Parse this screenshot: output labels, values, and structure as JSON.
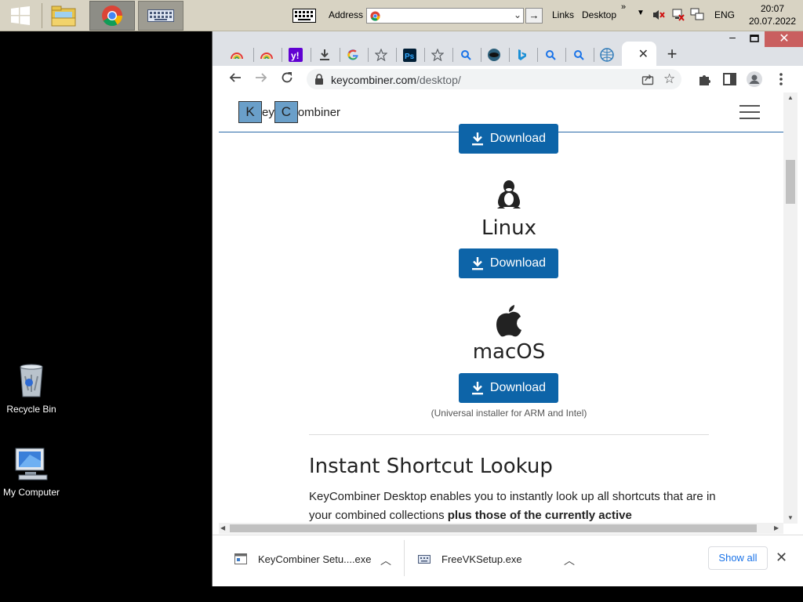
{
  "taskbar": {
    "address_label": "Address",
    "go_label": "→",
    "links_label": "Links",
    "desktop_label": "Desktop",
    "more_label": "»",
    "menu_label": "▼",
    "language": "ENG",
    "time": "20:07",
    "date": "20.07.2022"
  },
  "desktop": {
    "icons": [
      {
        "label": "Recycle Bin"
      },
      {
        "label": "My Computer"
      }
    ]
  },
  "browser": {
    "window_controls": {
      "minimize": "–",
      "close": "✕"
    },
    "active_tab_close": "✕",
    "new_tab": "+",
    "url_domain": "keycombiner.com",
    "url_path": "/desktop/"
  },
  "page": {
    "logo": {
      "key1": "K",
      "text1": "ey",
      "key2": "C",
      "text2": "ombiner"
    },
    "downloads": [
      {
        "os": "",
        "button": "Download"
      },
      {
        "os": "Linux",
        "button": "Download"
      },
      {
        "os": "macOS",
        "button": "Download"
      }
    ],
    "mac_note": "(Universal installer for ARM and Intel)",
    "section_title": "Instant Shortcut Lookup",
    "section_body_start": "KeyCombiner Desktop enables you to instantly look up all shortcuts that are in your combined collections ",
    "section_body_bold": "plus those of the currently active"
  },
  "download_bar": {
    "items": [
      {
        "name": "KeyCombiner Setu....exe"
      },
      {
        "name": "FreeVKSetup.exe"
      }
    ],
    "show_all": "Show all",
    "close": "✕"
  },
  "colors": {
    "taskbar": "#d8d3c3",
    "download_button": "#0d64a8",
    "header_border": "#2a6aa8",
    "show_all_text": "#1a73e8"
  }
}
